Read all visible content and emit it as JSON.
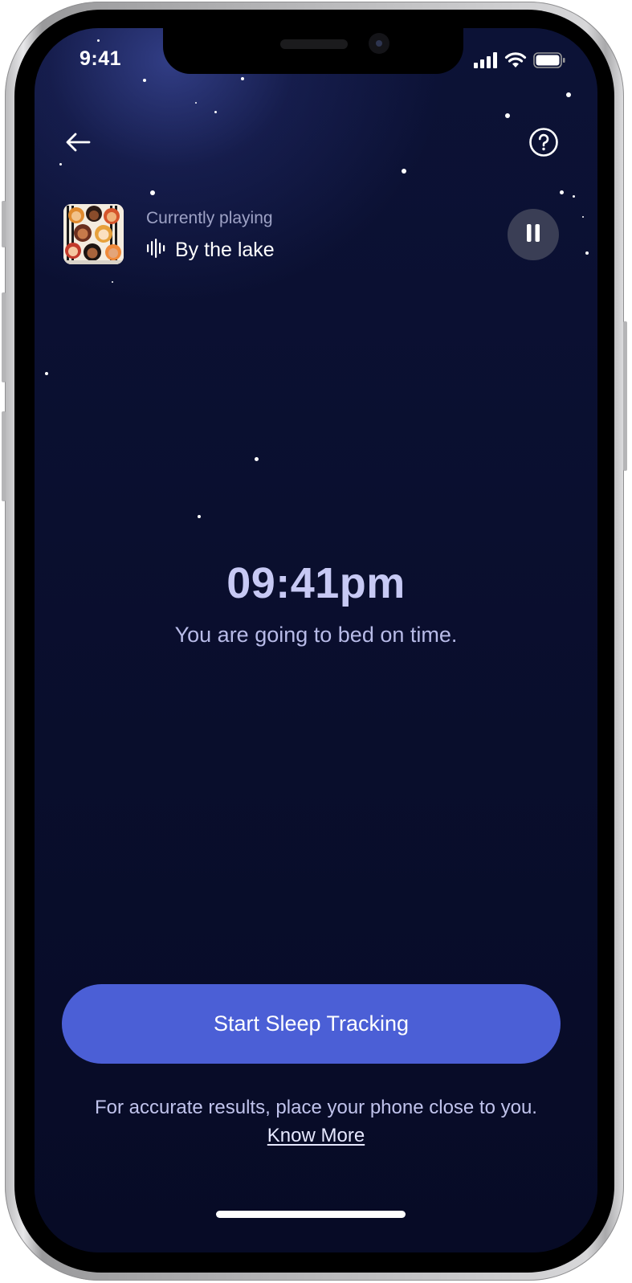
{
  "status_bar": {
    "time": "9:41",
    "icons": [
      "cellular-signal-icon",
      "wifi-icon",
      "battery-icon"
    ]
  },
  "header": {
    "back_icon": "arrow-left-icon",
    "help_icon": "question-circle-icon"
  },
  "now_playing": {
    "label": "Currently playing",
    "track_title": "By the lake",
    "wave_icon": "audio-wave-icon",
    "pause_icon": "pause-icon",
    "artwork": "album-artwork"
  },
  "main": {
    "time": "09:41pm",
    "message": "You are going to bed on time."
  },
  "actions": {
    "start_label": "Start Sleep Tracking"
  },
  "footer": {
    "note": "For accurate results, place your phone close to you.",
    "link_label": "Know More"
  },
  "colors": {
    "background": "#070b26",
    "accent": "#4b5fd6",
    "time_text": "#c7c9f4",
    "secondary_text": "#9ea2c5"
  }
}
